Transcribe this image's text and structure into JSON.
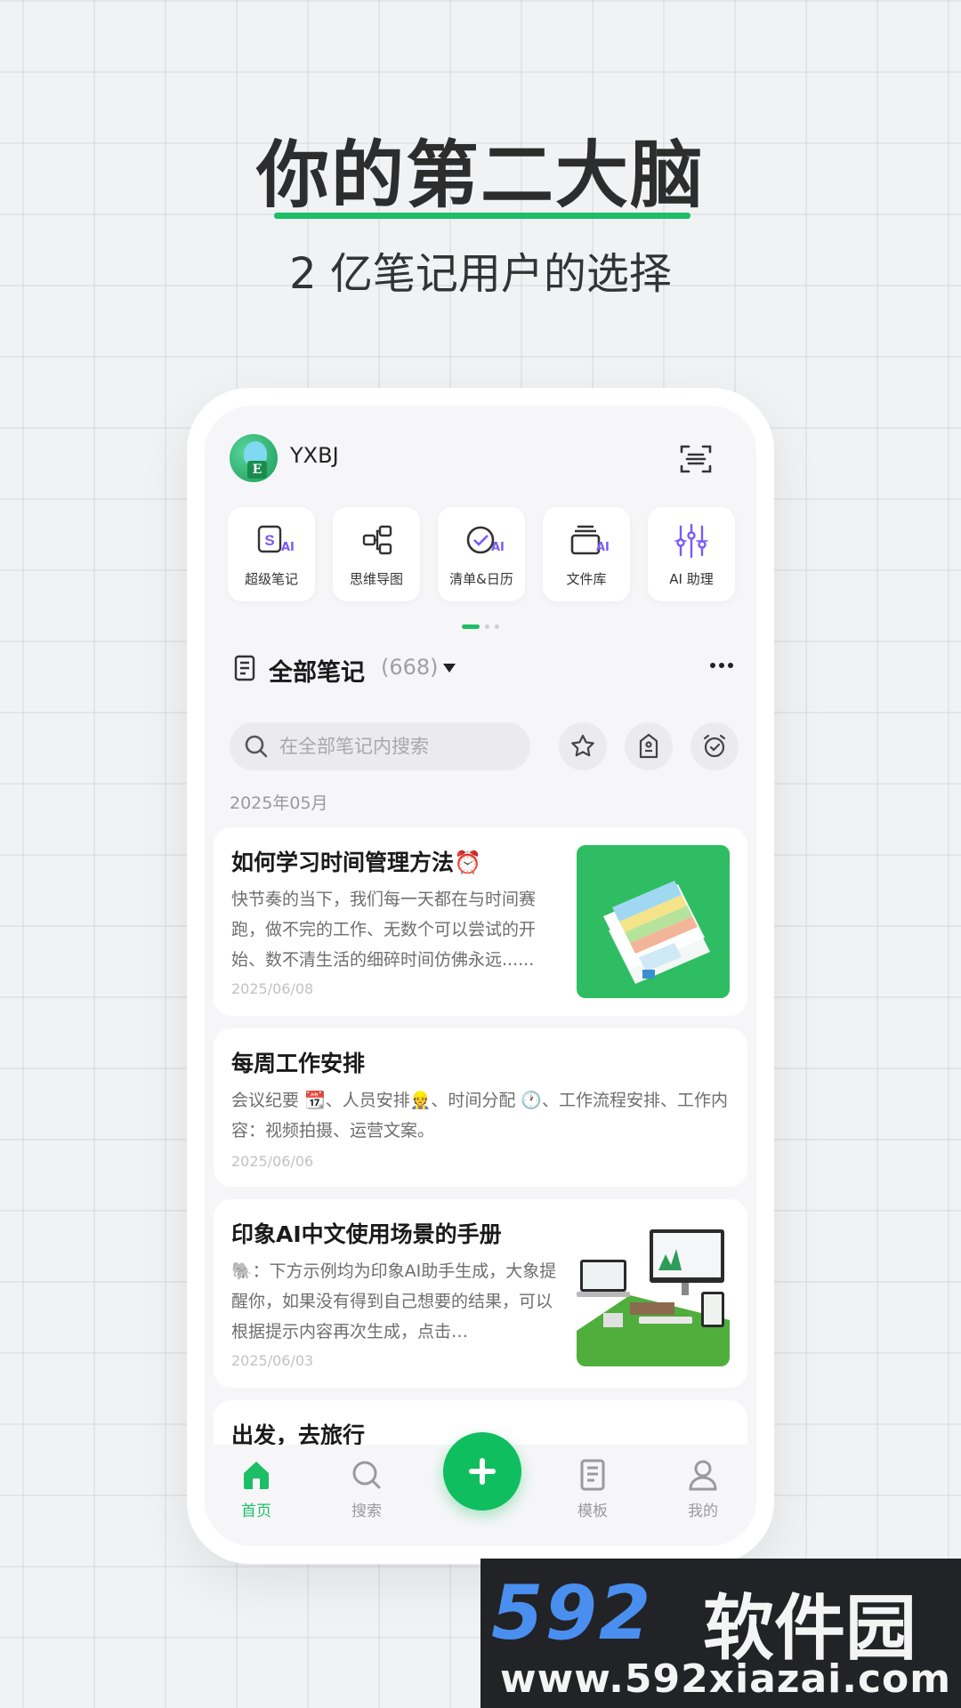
{
  "promo": {
    "headline": "你的第二大脑",
    "subline": "2 亿笔记用户的选择"
  },
  "header": {
    "username": "YXBJ",
    "avatar_letter": "E"
  },
  "shortcuts": [
    {
      "label": "超级笔记",
      "icon": "super-note-icon"
    },
    {
      "label": "思维导图",
      "icon": "mind-map-icon"
    },
    {
      "label": "清单&日历",
      "icon": "checklist-calendar-icon"
    },
    {
      "label": "文件库",
      "icon": "file-library-icon"
    },
    {
      "label": "AI 助理",
      "icon": "ai-assistant-icon"
    }
  ],
  "shortcut_ai_tag": "AI",
  "notes": {
    "title": "全部笔记",
    "count": "(668)",
    "search_placeholder": "在全部笔记内搜索",
    "group_date": "2025年05月"
  },
  "cards": [
    {
      "title": "如何学习时间管理方法⏰",
      "body": "快节奏的当下，我们每一天都在与时间赛跑，做不完的工作、无数个可以尝试的开始、数不清生活的细碎时间仿佛永远......",
      "date": "2025/06/08"
    },
    {
      "title": "每周工作安排",
      "body": "会议纪要 📆、人员安排👷、时间分配 🕐、工作流程安排、工作内容：视频拍摄、运营文案。",
      "date": "2025/06/06"
    },
    {
      "title": "印象AI中文使用场景的手册",
      "body": "🐘：下方示例均为印象AI助手生成，大象提醒你，如果没有得到自己想要的结果，可以根据提示内容再次生成，点击…",
      "date": "2025/06/03"
    },
    {
      "title": "出发，去旅行",
      "body": "",
      "date": ""
    }
  ],
  "bottom_nav": {
    "home": "首页",
    "search": "搜索",
    "templates": "模板",
    "me": "我的"
  },
  "watermark": {
    "brand_num": "592",
    "brand_cn": "软件园",
    "url": "www.592xiazai.com"
  },
  "colors": {
    "accent": "#1dbf66",
    "ai_purple": "#7a5af8"
  }
}
